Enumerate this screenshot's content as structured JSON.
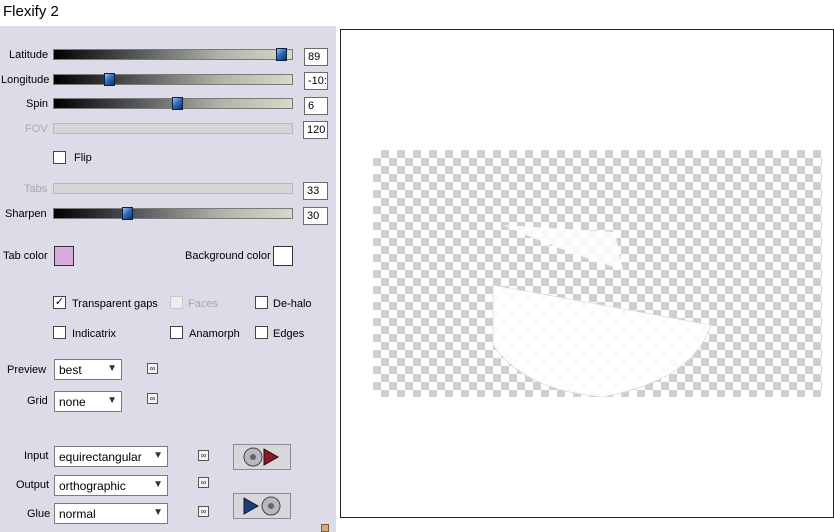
{
  "window": {
    "title": "Flexify 2"
  },
  "sliders": {
    "latitude": {
      "label": "Latitude",
      "value": "89",
      "fraction": 0.98,
      "enabled": true
    },
    "longitude": {
      "label": "Longitude",
      "value": "-10:",
      "fraction": 0.22,
      "enabled": true
    },
    "spin": {
      "label": "Spin",
      "value": "6",
      "fraction": 0.52,
      "enabled": true
    },
    "fov": {
      "label": "FOV",
      "value": "120",
      "enabled": false
    },
    "tabs": {
      "label": "Tabs",
      "value": "33",
      "enabled": false
    },
    "sharpen": {
      "label": "Sharpen",
      "value": "30",
      "fraction": 0.3,
      "enabled": true
    }
  },
  "flip": {
    "label": "Flip",
    "checked": false
  },
  "colors": {
    "tab_color": {
      "label": "Tab color",
      "value": "#d9a9dd"
    },
    "background_color": {
      "label": "Background color",
      "value": "#ffffff"
    }
  },
  "options": {
    "transparent_gaps": {
      "label": "Transparent gaps",
      "checked": true
    },
    "faces": {
      "label": "Faces",
      "checked": false,
      "enabled": false
    },
    "de_halo": {
      "label": "De-halo",
      "checked": false
    },
    "indicatrix": {
      "label": "Indicatrix",
      "checked": false
    },
    "anamorph": {
      "label": "Anamorph",
      "checked": false
    },
    "edges": {
      "label": "Edges",
      "checked": false
    }
  },
  "dropdowns": {
    "preview": {
      "label": "Preview",
      "value": "best"
    },
    "grid": {
      "label": "Grid",
      "value": "none"
    },
    "input": {
      "label": "Input",
      "value": "equirectangular"
    },
    "output": {
      "label": "Output",
      "value": "orthographic"
    },
    "glue": {
      "label": "Glue",
      "value": "normal"
    }
  },
  "icons": {
    "link": "link-icon",
    "input_action": "disc-to-arrow-icon",
    "output_action": "arrow-to-disc-icon"
  },
  "palette": {
    "panel_bg": "#dcdbe8",
    "slider_knob": "#2d6fb8",
    "checker": "#cfcfcf"
  }
}
